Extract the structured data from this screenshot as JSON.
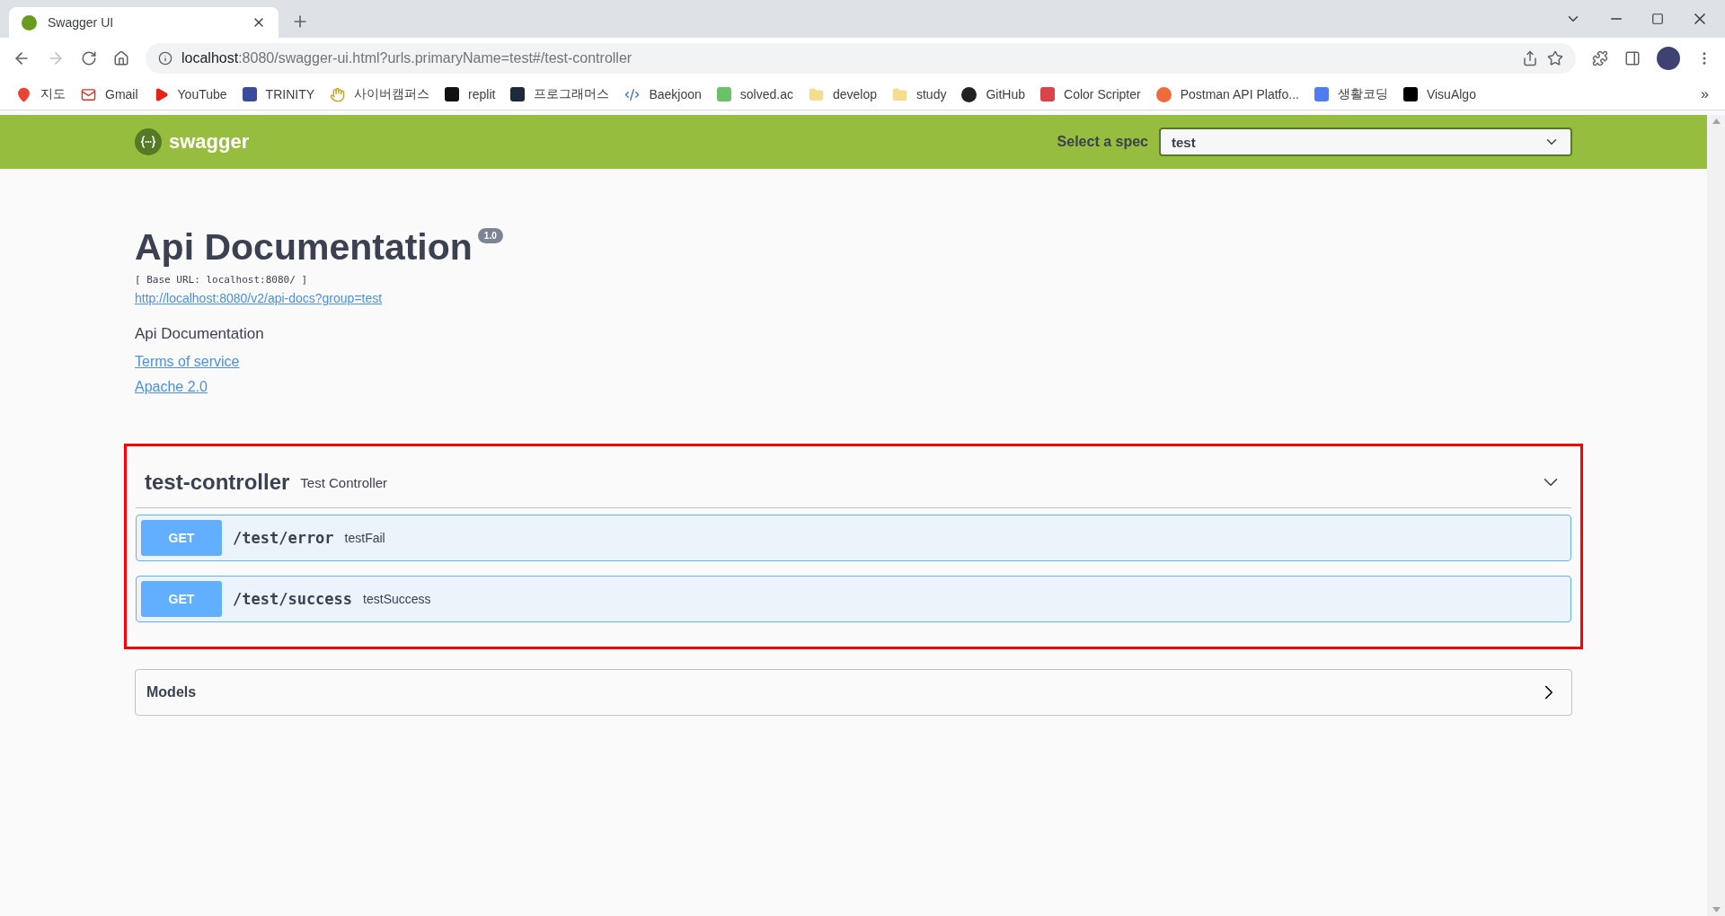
{
  "browser": {
    "tab": {
      "title": "Swagger UI",
      "selected": true
    },
    "url_host": "localhost",
    "url_rest": ":8080/swagger-ui.html?urls.primaryName=test#/test-controller",
    "bookmarks": [
      {
        "label": "지도",
        "kind": "pin",
        "color": "#ea4335"
      },
      {
        "label": "Gmail",
        "kind": "mail",
        "color": "#d93025"
      },
      {
        "label": "YouTube",
        "kind": "play",
        "color": "#e62117"
      },
      {
        "label": "TRINITY",
        "kind": "badge",
        "color": "#3b4a9c"
      },
      {
        "label": "사이버캠퍼스",
        "kind": "hand",
        "color": "#c9a227"
      },
      {
        "label": "replit",
        "kind": "badge",
        "color": "#111111"
      },
      {
        "label": "프로그래머스",
        "kind": "badge",
        "color": "#1e2a3a"
      },
      {
        "label": "Baekjoon",
        "kind": "code",
        "color": "#4a72c4"
      },
      {
        "label": "solved.ac",
        "kind": "badge",
        "color": "#6bc167"
      },
      {
        "label": "develop",
        "kind": "folder",
        "color": "#f5dd8f"
      },
      {
        "label": "study",
        "kind": "folder",
        "color": "#f5dd8f"
      },
      {
        "label": "GitHub",
        "kind": "circle",
        "color": "#222222"
      },
      {
        "label": "Color Scripter",
        "kind": "badge",
        "color": "#d9434b"
      },
      {
        "label": "Postman API Platfo...",
        "kind": "circle",
        "color": "#ef6c3a"
      },
      {
        "label": "생활코딩",
        "kind": "badge",
        "color": "#4f7cf0"
      },
      {
        "label": "VisuAlgo",
        "kind": "badge",
        "color": "#000000"
      }
    ],
    "more": "»"
  },
  "header": {
    "brand": "swagger",
    "spec_label": "Select a spec",
    "spec_value": "test"
  },
  "info": {
    "title": "Api Documentation",
    "version": "1.0",
    "base_url": "[ Base URL: localhost:8080/ ]",
    "docs_link": "http://localhost:8080/v2/api-docs?group=test",
    "description": "Api Documentation",
    "links": [
      "Terms of service",
      "Apache 2.0"
    ]
  },
  "tag": {
    "name": "test-controller",
    "description": "Test Controller",
    "expanded": true,
    "highlighted": true,
    "operations": [
      {
        "method": "GET",
        "path": "/test/error",
        "summary": "testFail"
      },
      {
        "method": "GET",
        "path": "/test/success",
        "summary": "testSuccess"
      }
    ]
  },
  "models": {
    "title": "Models",
    "expanded": false
  }
}
